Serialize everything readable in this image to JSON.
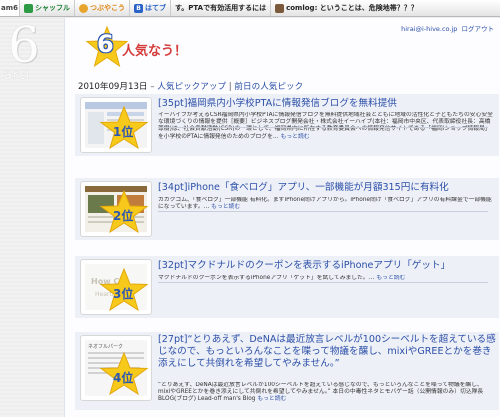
{
  "toolbar": {
    "logo": "am6",
    "share_label": "シャッフル",
    "tsubu_label": "つぶやこう",
    "hatebu_label": "はてブ",
    "news_text": "す。PTAで有効活用するには",
    "comlog_text": "comlog: ということは、危険地帯？？？"
  },
  "side_brand": {
    "number": "6",
    "text": "arti"
  },
  "user_nav": {
    "user": "hirai@i-hive.co.jp",
    "logout": "ログアウト"
  },
  "header": {
    "number": "6",
    "title": "人気なう！"
  },
  "dateline": {
    "date": "2010年09月13日",
    "dash": " – ",
    "section": "人気ピックアップ",
    "separator": " | ",
    "prev_day": "前日の人気ピック"
  },
  "colors": {
    "link": "#2b4fa8",
    "rank": "#2d56b4",
    "star": "#f7c91b",
    "title_red": "#d43c3c",
    "entry_bg": "#eef0f7"
  },
  "entries": [
    {
      "rank_label": "1位",
      "points": "[35pt]",
      "title": "福岡県内小学校PTAに情報発信ブログを無料提供",
      "excerpt": "イーハイブが考えるCSR福岡県内小学校PTAに情報発信ブログを無料提供地域社会とともに地域の活性化と子どもたちの安心安全な環境づくりの情報を提供［概要］ビジネスブログ開発会社・株式会社イーハイブ(本社：福岡市中央区、代表取締役社長：高橋尊樹)は、社会貢献活動(CSR)の一環として、福岡県内に所在する教育委員会への情報発信サイトである「福岡iショップ情報局」を小学校のPTAに情報発信のためのブログを…",
      "more": "もっと読む"
    },
    {
      "rank_label": "2位",
      "points": "[34pt]",
      "title": "iPhone「食べログ」アプリ、一部機能が月額315円に有料化",
      "excerpt": "カカクコム、「食べログ」一部機能 有料化。まずiPhone向けアプリから。iPhone向け「食べログ」アプリの有料課金で一部機能になっています。…",
      "more": "もっと読む"
    },
    {
      "rank_label": "3位",
      "points": "[32pt]",
      "title": "マクドナルドのクーポンを表示するiPhoneアプリ「ゲット」",
      "excerpt": "マクドナルドのクーポンを表示するiPhoneアプリ「ゲット」を試してみました。…",
      "more": "もっと読む"
    },
    {
      "rank_label": "4位",
      "points": "[27pt]",
      "title": "“とりあえず、DeNAは最近放言レベルが100シーベルトを超えている感じなので、もっといろんなことを喋って物議を醸し、mixiやGREEとかを巻き添えにして共倒れを希望してやみません。”",
      "excerpt": "“とりあえず、DeNAは最近放言レベルが100シーベルトを超えている感じなので、もっといろんなことを喋って物議を醸し、mixiやGREEとかを巻き添えにして共倒れを希望してやみません。” 本日の中毒性ネタとモバゲー話（公開情報のみ）切込隊長BLOG(ブログ) Lead-off man's Blog",
      "more": "もっと読む"
    }
  ]
}
